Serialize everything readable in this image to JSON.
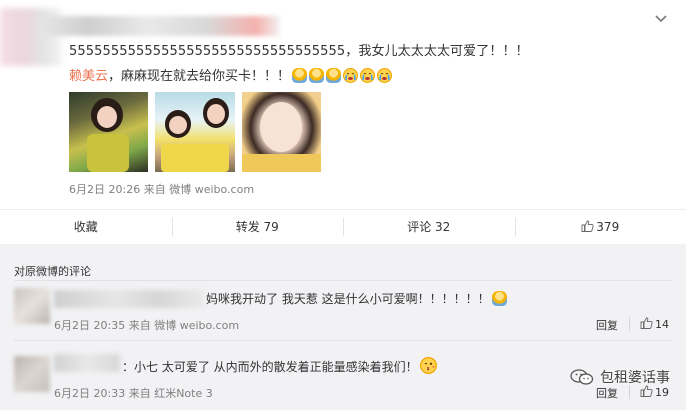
{
  "post": {
    "text_main": "555555555555555555555555555555555，我女儿太太太太可爱了！！！",
    "mention": "赖美云",
    "text_line2_rest": "，麻麻现在就去给你买卡！！！",
    "emoticons": [
      "doll-icon",
      "doll-icon",
      "doll-icon",
      "crying-face-icon",
      "crying-face-icon",
      "crying-face-icon"
    ],
    "date": "6月2日 20:26",
    "source_prefix": "来自",
    "source": "微博 weibo.com"
  },
  "actions": {
    "favorite": "收藏",
    "repost": "转发 79",
    "comment": "评论 32",
    "like": "379"
  },
  "comments_section": {
    "header": "对原微博的评论",
    "items": [
      {
        "text": "妈咪我开动了 我天惹 这是什么小可爱啊！！！！！！",
        "date": "6月2日 20:35",
        "source_prefix": "来自",
        "source": "微博 weibo.com",
        "reply": "回复",
        "likes": "14"
      },
      {
        "text": "：小七 太可爱了 从内而外的散发着正能量感染着我们！",
        "date": "6月2日 20:33",
        "source_prefix": "来自",
        "source": "红米Note 3",
        "reply": "回复",
        "likes": "19"
      }
    ]
  },
  "watermark": "包租婆话事",
  "colors": {
    "mention": "#eb7350",
    "meta": "#808080",
    "comments_bg": "#f2f2f5"
  }
}
